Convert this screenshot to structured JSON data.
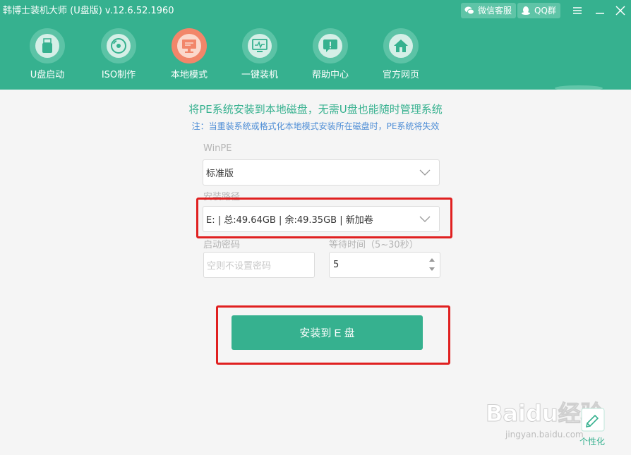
{
  "window": {
    "title": "韩博士装机大师 (U盘版) v.12.6.52.1960",
    "wechat_label": "微信客服",
    "qq_label": "QQ群"
  },
  "nav": {
    "items": [
      {
        "label": "U盘启动",
        "icon": "usb-drive-icon"
      },
      {
        "label": "ISO制作",
        "icon": "disc-icon"
      },
      {
        "label": "本地模式",
        "icon": "monitor-icon",
        "active": true
      },
      {
        "label": "一键装机",
        "icon": "pulse-monitor-icon"
      },
      {
        "label": "帮助中心",
        "icon": "help-bubble-icon"
      },
      {
        "label": "官方网页",
        "icon": "home-icon"
      }
    ]
  },
  "content": {
    "headline": "将PE系统安装到本地磁盘，无需U盘也能随时管理系统",
    "note": "注：当重装系统或格式化本地模式安装所在磁盘时，PE系统将失效",
    "winpe_label": "WinPE",
    "winpe_value": "标准版",
    "path_label": "安装路径",
    "path_value": "E: | 总:49.64GB | 余:49.35GB | 新加卷",
    "password_label": "启动密码",
    "password_placeholder": "空则不设置密码",
    "wait_label": "等待时间（5~30秒）",
    "wait_value": "5",
    "install_button": "安装到 E 盘"
  },
  "footer": {
    "watermark_text": "Baidu经验",
    "watermark_url": "jingyan.baidu.com",
    "skin_label": "个性化"
  },
  "colors": {
    "brand": "#36b18f",
    "active_nav": "#f2866a",
    "note_blue": "#4f8ed6",
    "highlight_red": "#e02020"
  }
}
